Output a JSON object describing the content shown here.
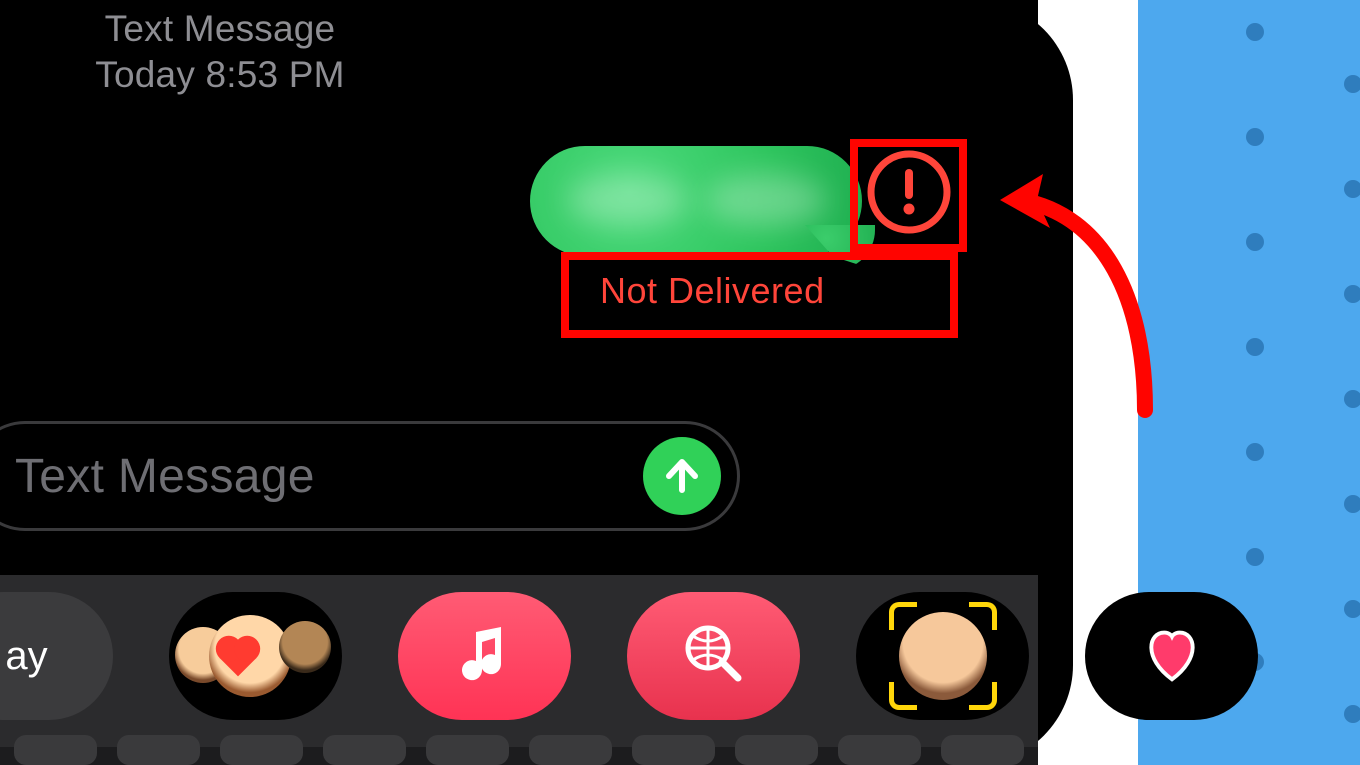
{
  "header": {
    "type": "Text Message",
    "timestamp": "Today 8:53 PM"
  },
  "bubble": {
    "status": "Not Delivered"
  },
  "input": {
    "placeholder": "Text Message"
  },
  "drawer": {
    "items": [
      {
        "label": "ay"
      },
      {
        "label": ""
      },
      {
        "label": ""
      },
      {
        "label": ""
      },
      {
        "label": ""
      },
      {
        "label": ""
      }
    ]
  },
  "colors": {
    "sms_green": "#30d158",
    "error_red": "#ff453a",
    "highlight_red": "#ff0400",
    "band_blue": "#4da8ee"
  }
}
